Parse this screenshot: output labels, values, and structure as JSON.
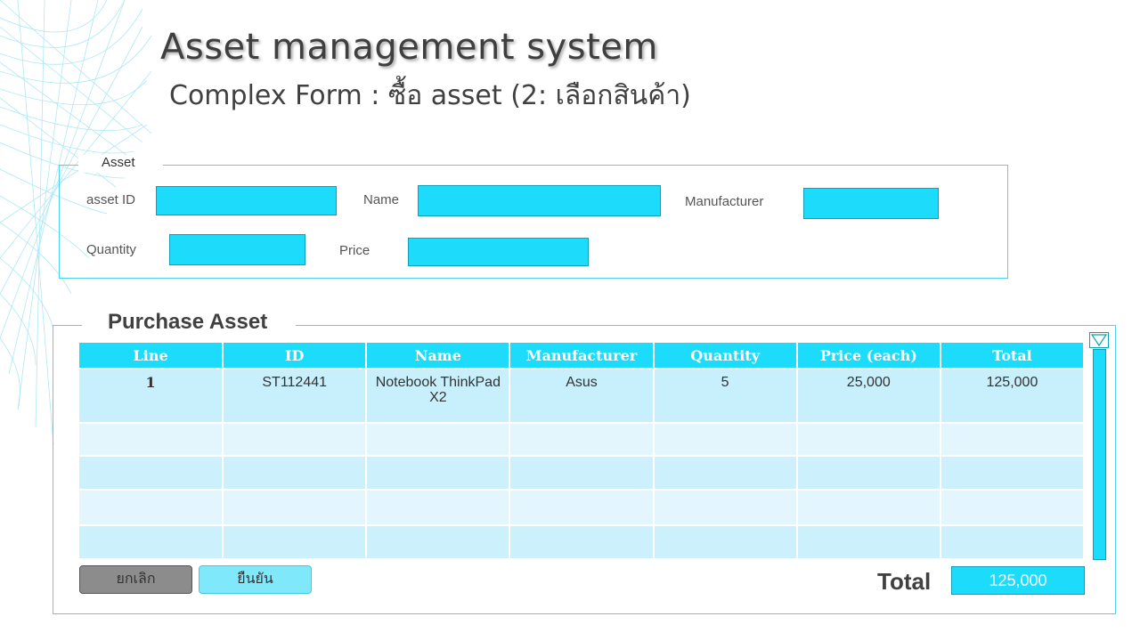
{
  "header": {
    "title": "Asset management system",
    "subtitle": "Complex Form : ซื้อ asset (2: เลือกสินค้า)"
  },
  "asset_form": {
    "legend": "Asset",
    "fields": {
      "asset_id": {
        "label": "asset ID",
        "value": ""
      },
      "name": {
        "label": "Name",
        "value": ""
      },
      "manufacturer": {
        "label": "Manufacturer",
        "value": ""
      },
      "quantity": {
        "label": "Quantity",
        "value": ""
      },
      "price": {
        "label": "Price",
        "value": ""
      }
    }
  },
  "purchase": {
    "legend": "Purchase Asset",
    "columns": [
      "Line",
      "ID",
      "Name",
      "Manufacturer",
      "Quantity",
      "Price (each)",
      "Total"
    ],
    "rows": [
      [
        "1",
        "ST112441",
        "Notebook ThinkPad X2",
        "Asus",
        "5",
        "25,000",
        "125,000"
      ]
    ],
    "cancel_label": "ยกเลิก",
    "confirm_label": "ยืนยัน",
    "total_label": "Total",
    "total_value": "125,000"
  },
  "colors": {
    "accent": "#1ddcfb",
    "border": "#4fd3ea",
    "row_light": "#e3f6fd",
    "row_dark": "#c8f0fc"
  }
}
